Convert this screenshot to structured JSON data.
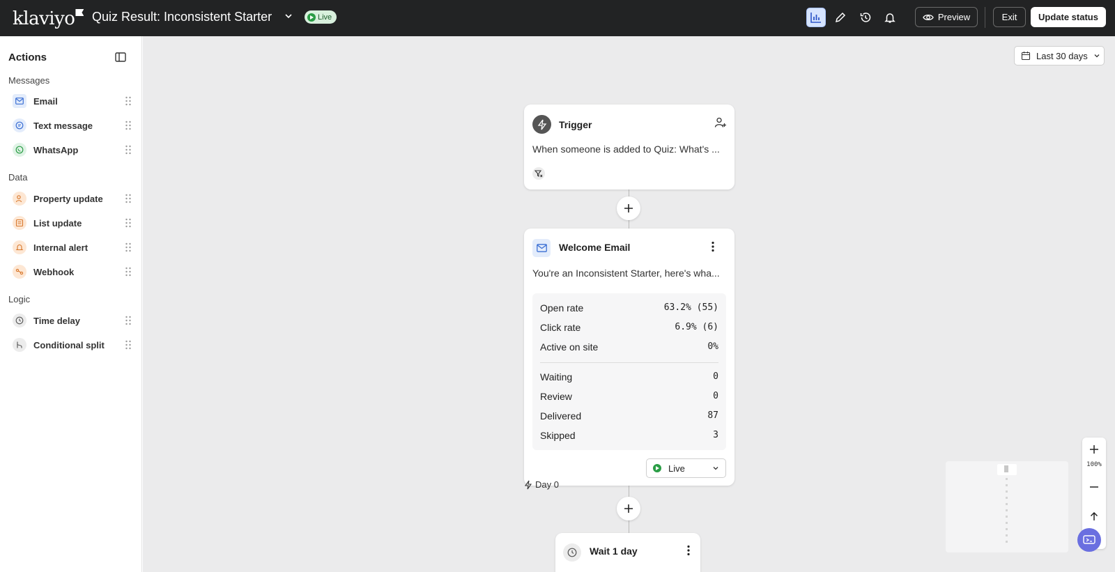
{
  "app": {
    "logo": "klaviyo"
  },
  "header": {
    "flow_title": "Quiz Result: Inconsistent Starter",
    "status_badge": "Live",
    "preview_label": "Preview",
    "exit_label": "Exit",
    "update_status_label": "Update status",
    "icons": [
      "analytics-icon",
      "edit-icon",
      "history-icon",
      "bell-icon"
    ]
  },
  "sidebar": {
    "title": "Actions",
    "sections": [
      {
        "label": "Messages",
        "items": [
          {
            "label": "Email",
            "icon": "mail-icon"
          },
          {
            "label": "Text message",
            "icon": "sms-icon"
          },
          {
            "label": "WhatsApp",
            "icon": "whatsapp-icon"
          }
        ]
      },
      {
        "label": "Data",
        "items": [
          {
            "label": "Property update",
            "icon": "person-edit-icon"
          },
          {
            "label": "List update",
            "icon": "list-icon"
          },
          {
            "label": "Internal alert",
            "icon": "bell-icon"
          },
          {
            "label": "Webhook",
            "icon": "webhook-icon"
          }
        ]
      },
      {
        "label": "Logic",
        "items": [
          {
            "label": "Time delay",
            "icon": "clock-icon"
          },
          {
            "label": "Conditional split",
            "icon": "split-icon"
          }
        ]
      }
    ]
  },
  "canvas": {
    "date_range": "Last 30 days",
    "trigger": {
      "title": "Trigger",
      "description": "When someone is added to Quiz: What's ..."
    },
    "email": {
      "title": "Welcome Email",
      "description": "You're an Inconsistent Starter, here's wha...",
      "stats": [
        {
          "label": "Open rate",
          "value": "63.2% (55)"
        },
        {
          "label": "Click rate",
          "value": "6.9% (6)"
        },
        {
          "label": "Active on site",
          "value": "0%"
        }
      ],
      "counts": [
        {
          "label": "Waiting",
          "value": "0"
        },
        {
          "label": "Review",
          "value": "0"
        },
        {
          "label": "Delivered",
          "value": "87"
        },
        {
          "label": "Skipped",
          "value": "3"
        }
      ],
      "status_select": "Live"
    },
    "day_label": "Day 0",
    "wait": {
      "title": "Wait 1 day"
    },
    "zoom_level": "100%"
  }
}
